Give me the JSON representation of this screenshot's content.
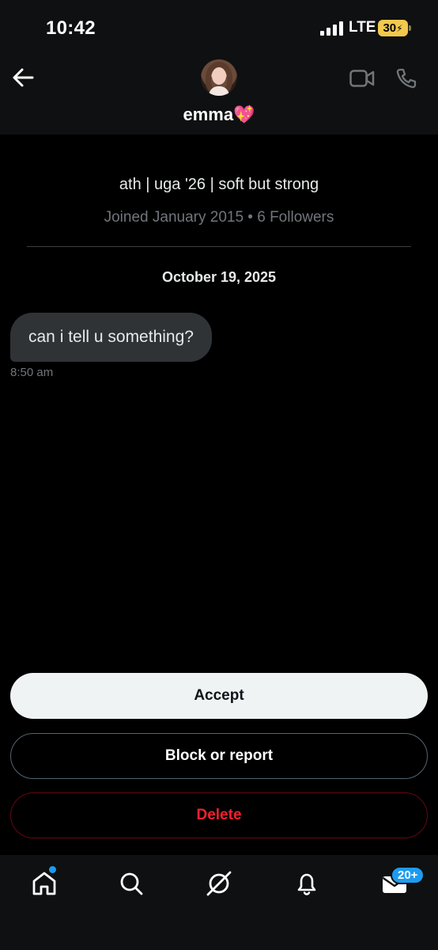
{
  "status_bar": {
    "time": "10:42",
    "network": "LTE",
    "battery": "30"
  },
  "header": {
    "name": "emma💖",
    "icons": [
      "back-arrow-icon",
      "video-icon",
      "phone-icon"
    ]
  },
  "profile": {
    "bio": "ath | uga '26 | soft but strong",
    "meta": "Joined January 2015 • 6 Followers"
  },
  "conversation": {
    "date": "October 19, 2025",
    "messages": [
      {
        "text": "can i tell u something?",
        "time": "8:50 am"
      }
    ]
  },
  "actions": {
    "accept": "Accept",
    "block": "Block or report",
    "delete": "Delete"
  },
  "tab_bar": {
    "items": [
      "home-icon",
      "search-icon",
      "grok-icon",
      "notifications-icon",
      "messages-icon"
    ],
    "messages_badge": "20+"
  },
  "colors": {
    "accent": "#1d9bf0",
    "danger": "#f4212e",
    "battery": "#f2c94c",
    "bubble": "#2f3336"
  }
}
